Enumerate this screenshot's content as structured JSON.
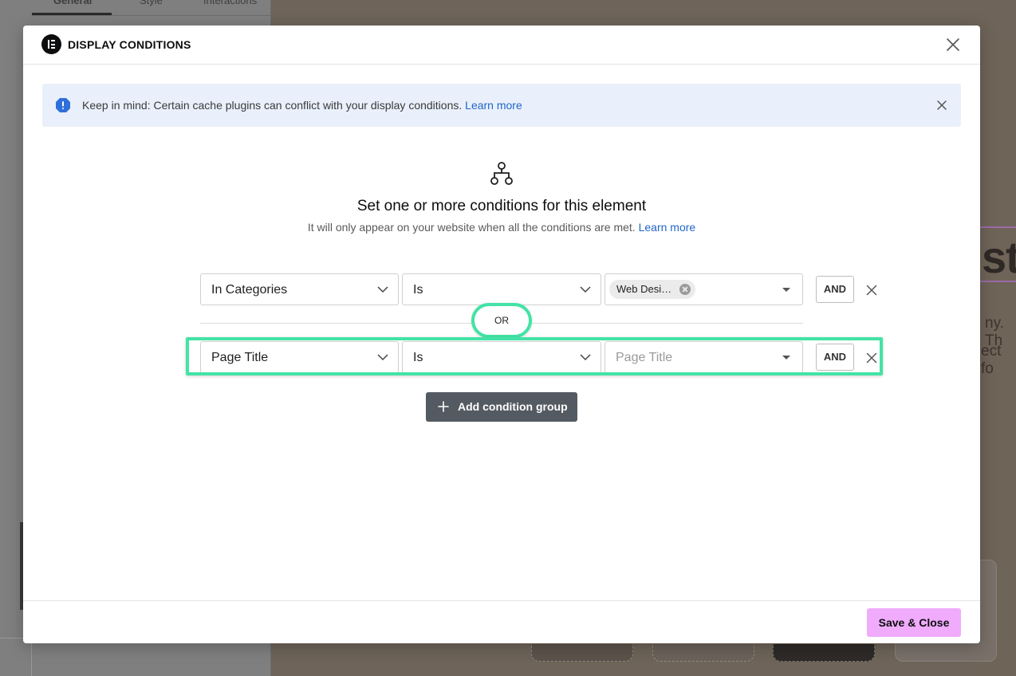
{
  "background": {
    "panel_tabs": [
      "General",
      "Style",
      "Interactions"
    ],
    "canvas_heading_fragment": "st",
    "canvas_text_line1": "ny. Th",
    "canvas_text_line2": "ect fo"
  },
  "modal": {
    "title": "DISPLAY CONDITIONS",
    "close_icon": "close-icon"
  },
  "notice": {
    "text": "Keep in mind: Certain cache plugins can conflict with your display conditions.",
    "link": "Learn more",
    "icon": "info-octagon-icon",
    "accent": "#2f6fdb"
  },
  "intro": {
    "heading": "Set one or more conditions for this element",
    "subtext": "It will only appear on your website when all the conditions are met.",
    "link": "Learn more",
    "icon": "sitemap-icon"
  },
  "groups": [
    {
      "field": "In Categories",
      "operator": "Is",
      "value_chip": "Web Desi…",
      "and_label": "AND"
    },
    {
      "field": "Page Title",
      "operator": "Is",
      "value_placeholder": "Page Title",
      "and_label": "AND"
    }
  ],
  "or_label": "OR",
  "add_group_label": "Add condition group",
  "footer": {
    "save_label": "Save & Close"
  },
  "colors": {
    "highlight": "#43e3a6",
    "save_button": "#f0abfc",
    "add_button": "#545a61",
    "notice_bg": "#e9f0fb",
    "link": "#2166c8"
  }
}
